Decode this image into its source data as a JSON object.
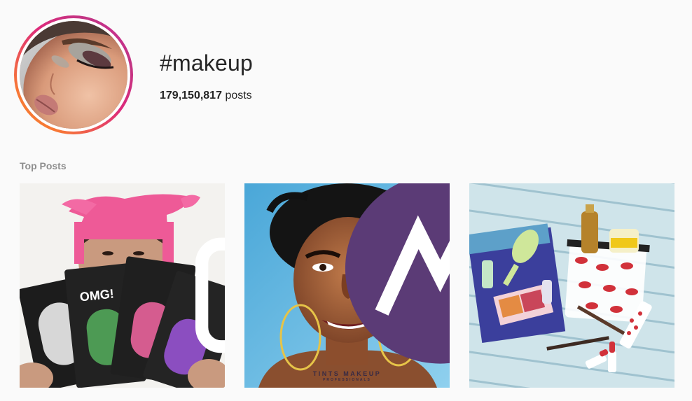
{
  "hashtag": {
    "title": "#makeup",
    "post_count": "179,150,817",
    "post_count_label": "posts"
  },
  "sections": {
    "top_posts_label": "Top Posts"
  },
  "posts": [
    {
      "kind": "video",
      "media_icon": "video-camera-icon",
      "product_text": "OMG!",
      "subject": "woman holding facial mask packs"
    },
    {
      "kind": "photo",
      "watermark_brand": "TINTS MAKEUP",
      "watermark_sub": "PROFESSIONALS",
      "subject": "smiling woman with hoop earrings"
    },
    {
      "kind": "photo",
      "subject": "makeup flat lay on blue wooden surface"
    }
  ],
  "colors": {
    "background": "#fafafa",
    "text": "#262626",
    "muted": "#8e8e8e",
    "story_ring_start": "#f58529",
    "story_ring_end": "#d6249f"
  }
}
